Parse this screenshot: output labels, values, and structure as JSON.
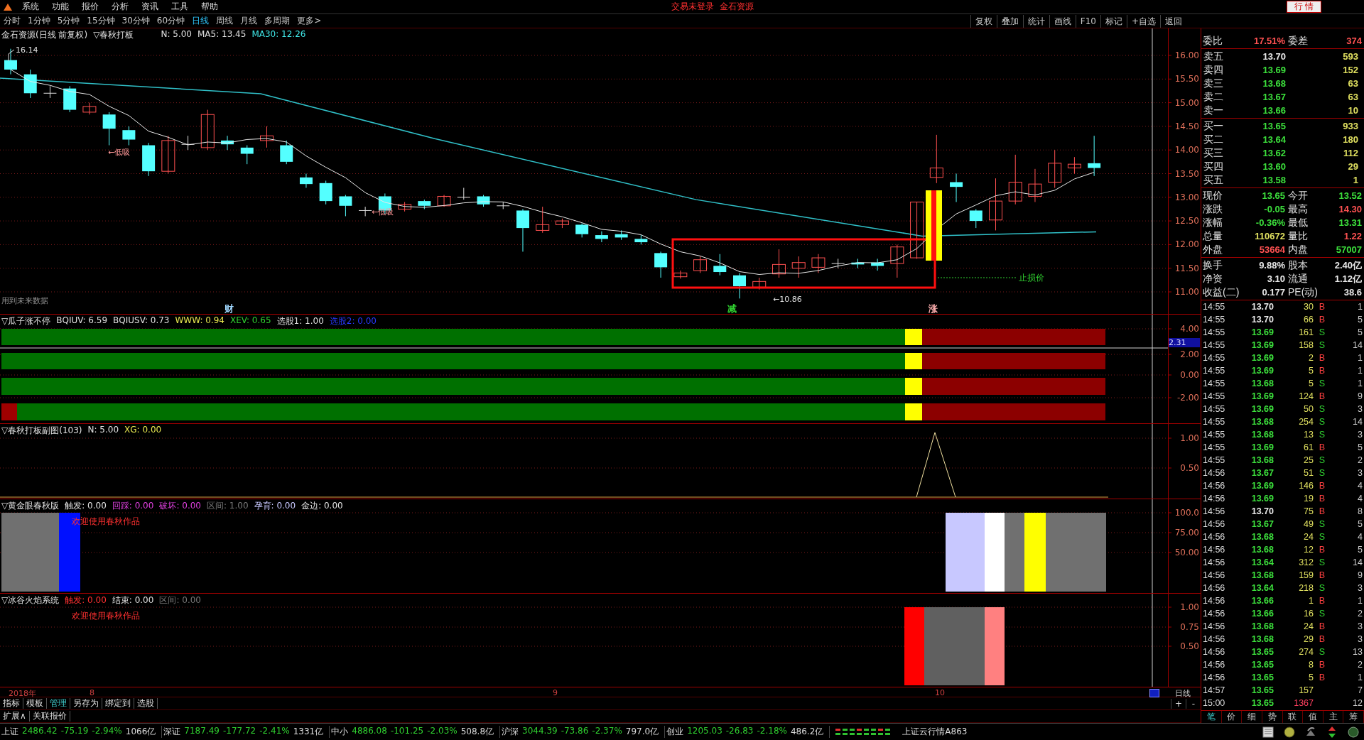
{
  "menu": {
    "items": [
      "系统",
      "功能",
      "报价",
      "分析",
      "资讯",
      "工具",
      "帮助"
    ],
    "login_status": "交易未登录",
    "stock_name": "金石资源",
    "quote_button": "行 情"
  },
  "periods": [
    {
      "label": "分时",
      "selected": false
    },
    {
      "label": "1分钟",
      "selected": false
    },
    {
      "label": "5分钟",
      "selected": false
    },
    {
      "label": "15分钟",
      "selected": false
    },
    {
      "label": "30分钟",
      "selected": false
    },
    {
      "label": "60分钟",
      "selected": false
    },
    {
      "label": "日线",
      "selected": true
    },
    {
      "label": "周线",
      "selected": false
    },
    {
      "label": "月线",
      "selected": false
    },
    {
      "label": "多周期",
      "selected": false
    },
    {
      "label": "更多>",
      "selected": false
    }
  ],
  "tools": [
    "复权",
    "叠加",
    "统计",
    "画线",
    "F10",
    "标记",
    "+自选",
    "返回"
  ],
  "main_chart": {
    "title": "金石资源(日线 前复权)",
    "indicator": "▽春秋打板",
    "params": [
      {
        "text": "N: 5.00",
        "color": "#e0e0e0"
      },
      {
        "text": "MA5: 13.45",
        "color": "#e0e0e0"
      },
      {
        "text": "MA30: 12.26",
        "color": "#40e8e8"
      }
    ],
    "axis": [
      "16.00",
      "15.50",
      "15.00",
      "14.50",
      "14.00",
      "13.50",
      "13.00",
      "12.50",
      "12.00",
      "11.50",
      "11.00"
    ],
    "high_label": "16.14",
    "low_label": "←10.86",
    "buy_marks": [
      "←低吸",
      "←低吸"
    ],
    "stop_label": "止损价",
    "warning": "用到未来数据",
    "signals": [
      {
        "text": "财",
        "color": "#a0d8ff"
      },
      {
        "text": "减",
        "color": "#30d030"
      },
      {
        "text": "涨",
        "color": "#ffb0b0"
      }
    ]
  },
  "panels": [
    {
      "kind": "bars",
      "title": "▽瓜子涨不停",
      "params": [
        {
          "text": "BQIUV: 6.59",
          "color": "#e0e0e0"
        },
        {
          "text": "BQIUSV: 0.73",
          "color": "#e0e0e0"
        },
        {
          "text": "WWW: 0.94",
          "color": "#e8e850"
        },
        {
          "text": "XEV: 0.65",
          "color": "#30d030"
        },
        {
          "text": "选股1: 1.00",
          "color": "#e0e0e0"
        },
        {
          "text": "选股2: 0.00",
          "color": "#2838ff"
        }
      ],
      "axis": [
        "4.00",
        "2.00",
        "0.00",
        "-2.00"
      ],
      "cursor_value": "2.31"
    },
    {
      "kind": "spike",
      "title": "▽春秋打板副图(103)",
      "params": [
        {
          "text": "N: 5.00",
          "color": "#e0e0e0"
        },
        {
          "text": "XG: 0.00",
          "color": "#e8e850"
        }
      ],
      "axis": [
        "1.00",
        "0.50"
      ]
    },
    {
      "kind": "eye",
      "title": "▽黄金眼春秋版",
      "params": [
        {
          "text": "触发: 0.00",
          "color": "#e0e0e0"
        },
        {
          "text": "回踩: 0.00",
          "color": "#e040e0"
        },
        {
          "text": "破坏: 0.00",
          "color": "#e040e0"
        },
        {
          "text": "区间: 1.00",
          "color": "#7a7a7a"
        },
        {
          "text": "孕育: 0.00",
          "color": "#c8c8ff"
        },
        {
          "text": "金边: 0.00",
          "color": "#e0e0e0"
        }
      ],
      "axis": [
        "100.0",
        "75.00",
        "50.00"
      ],
      "note": "欢迎使用春秋作品"
    },
    {
      "kind": "flame",
      "title": "▽冰谷火焰系统",
      "params": [
        {
          "text": "触发: 0.00",
          "color": "#ff3030"
        },
        {
          "text": "结束: 0.00",
          "color": "#e0e0e0"
        },
        {
          "text": "区间: 0.00",
          "color": "#7a7a7a"
        }
      ],
      "axis": [
        "1.00",
        "0.75",
        "0.50"
      ],
      "note": "欢迎使用春秋作品"
    }
  ],
  "date_axis": [
    "2018年",
    "8",
    "9",
    "10"
  ],
  "period_label": "日线",
  "bottom_tabs": [
    {
      "label": "指标",
      "selected": false
    },
    {
      "label": "模板",
      "selected": false
    },
    {
      "label": "管理",
      "selected": true
    },
    {
      "label": "另存为",
      "selected": false
    },
    {
      "label": "绑定到",
      "selected": false
    },
    {
      "label": "选股",
      "selected": false
    }
  ],
  "zoom_buttons": [
    "+",
    "-"
  ],
  "extra_tabs": [
    "扩展∧",
    "关联报价"
  ],
  "quote": {
    "ratio": [
      {
        "label": "委比",
        "value": "17.51%",
        "color": "#ff5252"
      },
      {
        "label": "委差",
        "value": "374",
        "color": "#ff5252"
      }
    ],
    "asks": [
      {
        "label": "卖五",
        "price": "13.70",
        "color": "#e8e8e8",
        "volume": "593"
      },
      {
        "label": "卖四",
        "price": "13.69",
        "color": "#3ce03c",
        "volume": "152"
      },
      {
        "label": "卖三",
        "price": "13.68",
        "color": "#3ce03c",
        "volume": "63"
      },
      {
        "label": "卖二",
        "price": "13.67",
        "color": "#3ce03c",
        "volume": "63"
      },
      {
        "label": "卖一",
        "price": "13.66",
        "color": "#3ce03c",
        "volume": "10"
      }
    ],
    "bids": [
      {
        "label": "买一",
        "price": "13.65",
        "color": "#3ce03c",
        "volume": "933"
      },
      {
        "label": "买二",
        "price": "13.64",
        "color": "#3ce03c",
        "volume": "180"
      },
      {
        "label": "买三",
        "price": "13.62",
        "color": "#3ce03c",
        "volume": "112"
      },
      {
        "label": "买四",
        "price": "13.60",
        "color": "#3ce03c",
        "volume": "29"
      },
      {
        "label": "买五",
        "price": "13.58",
        "color": "#3ce03c",
        "volume": "1"
      }
    ],
    "stats": [
      {
        "label": "现价",
        "value": "13.65",
        "color": "#3ce03c"
      },
      {
        "label": "今开",
        "value": "13.52",
        "color": "#3ce03c"
      },
      {
        "label": "涨跌",
        "value": "-0.05",
        "color": "#3ce03c"
      },
      {
        "label": "最高",
        "value": "14.30",
        "color": "#ff5252"
      },
      {
        "label": "涨幅",
        "value": "-0.36%",
        "color": "#3ce03c"
      },
      {
        "label": "最低",
        "value": "13.31",
        "color": "#3ce03c"
      },
      {
        "label": "总量",
        "value": "110672",
        "color": "#e0e060"
      },
      {
        "label": "量比",
        "value": "1.22",
        "color": "#ff5252"
      },
      {
        "label": "外盘",
        "value": "53664",
        "color": "#ff5252"
      },
      {
        "label": "内盘",
        "value": "57007",
        "color": "#3ce03c"
      }
    ],
    "fundamentals": [
      {
        "label": "换手",
        "value": "9.88%"
      },
      {
        "label": "股本",
        "value": "2.40亿"
      },
      {
        "label": "净资",
        "value": "3.10"
      },
      {
        "label": "流通",
        "value": "1.12亿"
      },
      {
        "label": "收益(二)",
        "value": "0.177"
      },
      {
        "label": "PE(动)",
        "value": "38.6"
      }
    ],
    "ticks": [
      {
        "time": "14:55",
        "price": {
          "text": "13.70",
          "color": "#e8e8e8"
        },
        "volume": "30",
        "bs": {
          "text": "B",
          "color": "#ff4040"
        },
        "count": "1",
        "hot": false
      },
      {
        "time": "14:55",
        "price": {
          "text": "13.70",
          "color": "#e8e8e8"
        },
        "volume": "66",
        "bs": {
          "text": "B",
          "color": "#ff4040"
        },
        "count": "5",
        "hot": false
      },
      {
        "time": "14:55",
        "price": {
          "text": "13.69",
          "color": "#3ce03c"
        },
        "volume": "161",
        "bs": {
          "text": "S",
          "color": "#30d030"
        },
        "count": "5",
        "hot": false
      },
      {
        "time": "14:55",
        "price": {
          "text": "13.69",
          "color": "#3ce03c"
        },
        "volume": "158",
        "bs": {
          "text": "S",
          "color": "#30d030"
        },
        "count": "14",
        "hot": false
      },
      {
        "time": "14:55",
        "price": {
          "text": "13.69",
          "color": "#3ce03c"
        },
        "volume": "2",
        "bs": {
          "text": "B",
          "color": "#ff4040"
        },
        "count": "1",
        "hot": false
      },
      {
        "time": "14:55",
        "price": {
          "text": "13.69",
          "color": "#3ce03c"
        },
        "volume": "5",
        "bs": {
          "text": "B",
          "color": "#ff4040"
        },
        "count": "1",
        "hot": false
      },
      {
        "time": "14:55",
        "price": {
          "text": "13.68",
          "color": "#3ce03c"
        },
        "volume": "5",
        "bs": {
          "text": "S",
          "color": "#30d030"
        },
        "count": "1",
        "hot": false
      },
      {
        "time": "14:55",
        "price": {
          "text": "13.69",
          "color": "#3ce03c"
        },
        "volume": "124",
        "bs": {
          "text": "B",
          "color": "#ff4040"
        },
        "count": "9",
        "hot": false
      },
      {
        "time": "14:55",
        "price": {
          "text": "13.69",
          "color": "#3ce03c"
        },
        "volume": "50",
        "bs": {
          "text": "S",
          "color": "#30d030"
        },
        "count": "3",
        "hot": false
      },
      {
        "time": "14:55",
        "price": {
          "text": "13.68",
          "color": "#3ce03c"
        },
        "volume": "254",
        "bs": {
          "text": "S",
          "color": "#30d030"
        },
        "count": "14",
        "hot": false
      },
      {
        "time": "14:55",
        "price": {
          "text": "13.68",
          "color": "#3ce03c"
        },
        "volume": "13",
        "bs": {
          "text": "S",
          "color": "#30d030"
        },
        "count": "3",
        "hot": false
      },
      {
        "time": "14:55",
        "price": {
          "text": "13.69",
          "color": "#3ce03c"
        },
        "volume": "61",
        "bs": {
          "text": "B",
          "color": "#ff4040"
        },
        "count": "5",
        "hot": false
      },
      {
        "time": "14:55",
        "price": {
          "text": "13.68",
          "color": "#3ce03c"
        },
        "volume": "25",
        "bs": {
          "text": "S",
          "color": "#30d030"
        },
        "count": "2",
        "hot": false
      },
      {
        "time": "14:56",
        "price": {
          "text": "13.67",
          "color": "#3ce03c"
        },
        "volume": "51",
        "bs": {
          "text": "S",
          "color": "#30d030"
        },
        "count": "3",
        "hot": false
      },
      {
        "time": "14:56",
        "price": {
          "text": "13.69",
          "color": "#3ce03c"
        },
        "volume": "146",
        "bs": {
          "text": "B",
          "color": "#ff4040"
        },
        "count": "4",
        "hot": false
      },
      {
        "time": "14:56",
        "price": {
          "text": "13.69",
          "color": "#3ce03c"
        },
        "volume": "19",
        "bs": {
          "text": "B",
          "color": "#ff4040"
        },
        "count": "4",
        "hot": false
      },
      {
        "time": "14:56",
        "price": {
          "text": "13.70",
          "color": "#e8e8e8"
        },
        "volume": "75",
        "bs": {
          "text": "B",
          "color": "#ff4040"
        },
        "count": "8",
        "hot": false
      },
      {
        "time": "14:56",
        "price": {
          "text": "13.67",
          "color": "#3ce03c"
        },
        "volume": "49",
        "bs": {
          "text": "S",
          "color": "#30d030"
        },
        "count": "5",
        "hot": false
      },
      {
        "time": "14:56",
        "price": {
          "text": "13.68",
          "color": "#3ce03c"
        },
        "volume": "24",
        "bs": {
          "text": "S",
          "color": "#30d030"
        },
        "count": "4",
        "hot": false
      },
      {
        "time": "14:56",
        "price": {
          "text": "13.68",
          "color": "#3ce03c"
        },
        "volume": "12",
        "bs": {
          "text": "B",
          "color": "#ff4040"
        },
        "count": "5",
        "hot": false
      },
      {
        "time": "14:56",
        "price": {
          "text": "13.64",
          "color": "#3ce03c"
        },
        "volume": "312",
        "bs": {
          "text": "S",
          "color": "#30d030"
        },
        "count": "14",
        "hot": false
      },
      {
        "time": "14:56",
        "price": {
          "text": "13.68",
          "color": "#3ce03c"
        },
        "volume": "159",
        "bs": {
          "text": "B",
          "color": "#ff4040"
        },
        "count": "9",
        "hot": false
      },
      {
        "time": "14:56",
        "price": {
          "text": "13.64",
          "color": "#3ce03c"
        },
        "volume": "218",
        "bs": {
          "text": "S",
          "color": "#30d030"
        },
        "count": "3",
        "hot": false
      },
      {
        "time": "14:56",
        "price": {
          "text": "13.66",
          "color": "#3ce03c"
        },
        "volume": "1",
        "bs": {
          "text": "B",
          "color": "#ff4040"
        },
        "count": "1",
        "hot": false
      },
      {
        "time": "14:56",
        "price": {
          "text": "13.66",
          "color": "#3ce03c"
        },
        "volume": "16",
        "bs": {
          "text": "S",
          "color": "#30d030"
        },
        "count": "2",
        "hot": false
      },
      {
        "time": "14:56",
        "price": {
          "text": "13.68",
          "color": "#3ce03c"
        },
        "volume": "24",
        "bs": {
          "text": "B",
          "color": "#ff4040"
        },
        "count": "3",
        "hot": false
      },
      {
        "time": "14:56",
        "price": {
          "text": "13.68",
          "color": "#3ce03c"
        },
        "volume": "29",
        "bs": {
          "text": "B",
          "color": "#ff4040"
        },
        "count": "3",
        "hot": false
      },
      {
        "time": "14:56",
        "price": {
          "text": "13.65",
          "color": "#3ce03c"
        },
        "volume": "274",
        "bs": {
          "text": "S",
          "color": "#30d030"
        },
        "count": "13",
        "hot": false
      },
      {
        "time": "14:56",
        "price": {
          "text": "13.65",
          "color": "#3ce03c"
        },
        "volume": "8",
        "bs": {
          "text": "B",
          "color": "#ff4040"
        },
        "count": "2",
        "hot": false
      },
      {
        "time": "14:56",
        "price": {
          "text": "13.65",
          "color": "#3ce03c"
        },
        "volume": "5",
        "bs": {
          "text": "B",
          "color": "#ff4040"
        },
        "count": "1",
        "hot": false
      },
      {
        "time": "14:57",
        "price": {
          "text": "13.65",
          "color": "#3ce03c"
        },
        "volume": "157",
        "count": "7",
        "hot": false
      },
      {
        "time": "15:00",
        "price": {
          "text": "13.65",
          "color": "#3ce03c"
        },
        "volume": "1367",
        "count": "12",
        "hot": true
      }
    ],
    "tabs": [
      {
        "label": "笔",
        "selected": true
      },
      {
        "label": "价",
        "selected": false
      },
      {
        "label": "细",
        "selected": false
      },
      {
        "label": "势",
        "selected": false
      },
      {
        "label": "联",
        "selected": false
      },
      {
        "label": "值",
        "selected": false
      },
      {
        "label": "主",
        "selected": false
      },
      {
        "label": "筹",
        "selected": false
      }
    ]
  },
  "status_bar": {
    "indices": [
      {
        "name": "上证",
        "value": "2486.42",
        "change": "-75.19",
        "pct": "-2.94%",
        "amount": "1066亿"
      },
      {
        "name": "深证",
        "value": "7187.49",
        "change": "-177.72",
        "pct": "-2.41%",
        "amount": "1331亿"
      },
      {
        "name": "中小",
        "value": "4886.08",
        "change": "-101.25",
        "pct": "-2.03%",
        "amount": "508.8亿"
      },
      {
        "name": "沪深",
        "value": "3044.39",
        "change": "-73.86",
        "pct": "-2.37%",
        "amount": "797.0亿"
      },
      {
        "name": "创业",
        "value": "1205.03",
        "change": "-26.83",
        "pct": "-2.18%",
        "amount": "486.2亿"
      }
    ],
    "cloud": "上证云行情A863"
  }
}
